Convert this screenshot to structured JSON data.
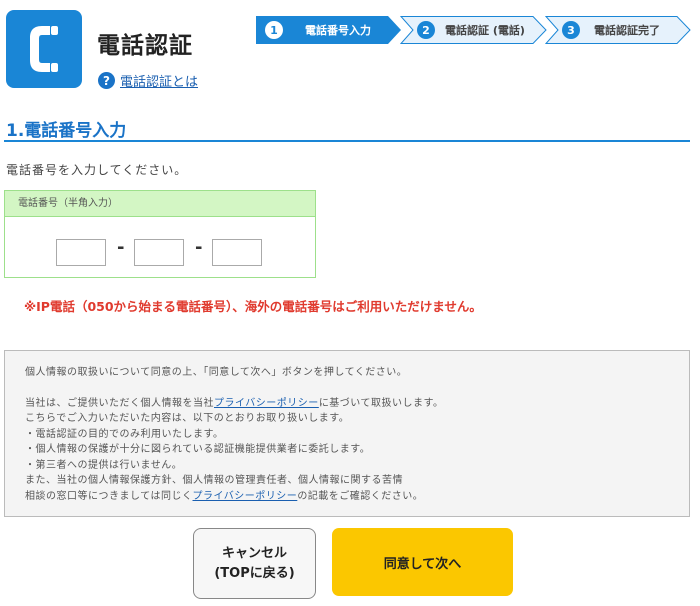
{
  "header": {
    "title": "電話認証",
    "help_link": "電話認証とは",
    "icon": "phone-handset-icon"
  },
  "steps": [
    {
      "number": "1",
      "label": "電話番号入力",
      "active": true
    },
    {
      "number": "2",
      "label": "電話認証 (電話)",
      "active": false
    },
    {
      "number": "3",
      "label": "電話認証完了",
      "active": false
    }
  ],
  "section": {
    "title": "1.電話番号入力",
    "instruction": "電話番号を入力してください。"
  },
  "phone_form": {
    "header_label": "電話番号（半角入力）",
    "field1_value": "",
    "field2_value": "",
    "field3_value": "",
    "separator": "-"
  },
  "warning": "※IP電話（050から始まる電話番号）、海外の電話番号はご利用いただけません。",
  "privacy": {
    "intro": "個人情報の取扱いについて同意の上、「同意して次へ」ボタンを押してください。",
    "line1_pre": "当社は、ご提供いただく個人情報を当社",
    "line1_link": "プライバシーポリシー",
    "line1_post": "に基づいて取扱いします。",
    "line2": "こちらでご入力いただいた内容は、以下のとおりお取り扱いします。",
    "bullet1": "・電話認証の目的でのみ利用いたします。",
    "bullet2": "・個人情報の保護が十分に図られている認証機能提供業者に委託します。",
    "bullet3": "・第三者への提供は行いません。",
    "line3": "また、当社の個人情報保護方針、個人情報の管理責任者、個人情報に関する苦情",
    "line4_pre": "相談の窓口等につきましては同じく",
    "line4_link": "プライバシーポリシー",
    "line4_post": "の記載をご確認ください。"
  },
  "buttons": {
    "cancel_line1": "キャンセル",
    "cancel_line2": "(TOPに戻る)",
    "agree": "同意して次へ"
  },
  "colors": {
    "primary_blue": "#1a86d6",
    "warning_red": "#e03a2e",
    "agree_yellow": "#fbc700",
    "form_green": "#d3f6c4"
  }
}
